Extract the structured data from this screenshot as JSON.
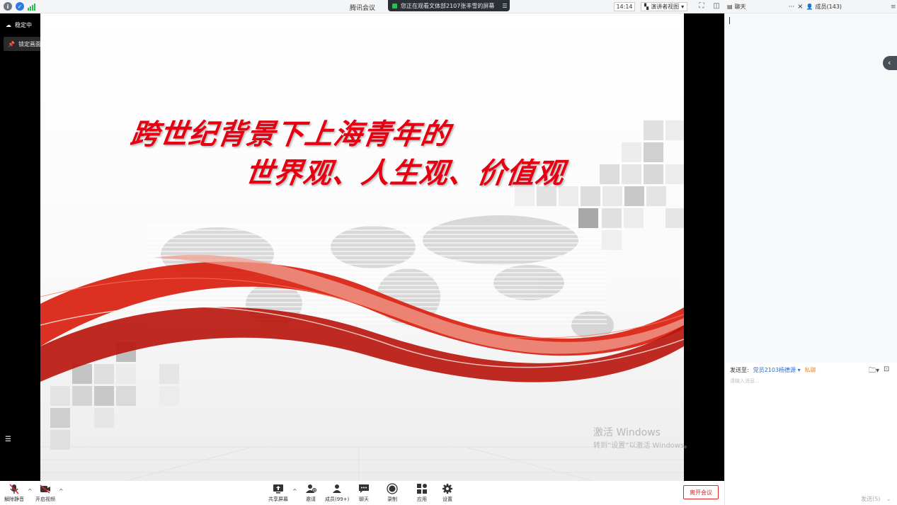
{
  "window": {
    "title": "腾讯会议",
    "watching_banner": "您正在观看文体部2107张丰雪的屏幕",
    "time": "14:14",
    "view_mode": "演讲者视图"
  },
  "sidebar": {
    "tabs": [
      {
        "label": "聊天"
      },
      {
        "label": "成员(143)"
      }
    ],
    "more": "···",
    "close": "×",
    "send_to_label": "发送至:",
    "send_target": "党员2103杨德源",
    "private_label": "私聊",
    "input_placeholder": "请输入消息...",
    "send_button": "发送(S)"
  },
  "video_area": {
    "network_status": "稳定中",
    "pin_label": "锁定画面"
  },
  "slide": {
    "title_line1": "跨世纪背景下上海青年的",
    "title_line2": "世界观、人生观、价值观",
    "watermark_line1": "激活 Windows",
    "watermark_line2": "转到“设置”以激活 Windows。"
  },
  "toolbar": {
    "unmute": "解除静音",
    "start_video": "开启视频",
    "share_screen": "共享屏幕",
    "invite": "邀请",
    "members": "成员(99+)",
    "chat": "聊天",
    "record": "录制",
    "apps": "应用",
    "settings": "设置",
    "leave": "离开会议"
  },
  "colors": {
    "accent_red": "#e0242b",
    "title_red": "#e60012",
    "link_blue": "#1f6fe3",
    "private_orange": "#f08a24"
  }
}
